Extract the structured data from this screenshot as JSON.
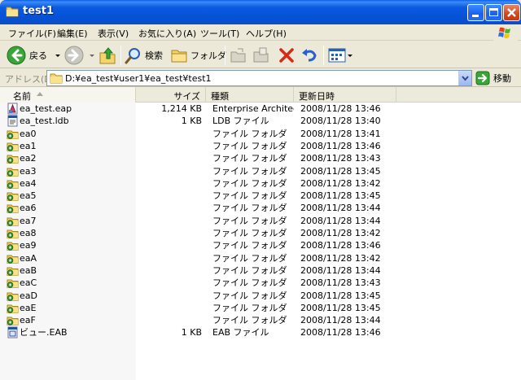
{
  "window": {
    "title": "test1",
    "minimize_icon": "minimize-icon",
    "maximize_icon": "maximize-icon",
    "close_icon": "close-icon"
  },
  "menu": [
    {
      "label": "ファイル(F)"
    },
    {
      "label": "編集(E)"
    },
    {
      "label": "表示(V)"
    },
    {
      "label": "お気に入り(A)"
    },
    {
      "label": "ツール(T)"
    },
    {
      "label": "ヘルプ(H)"
    }
  ],
  "toolbar": {
    "back_label": "戻る",
    "search_label": "検索",
    "folders_label": "フォルダ"
  },
  "address": {
    "label": "アドレス(D)",
    "value": "D:¥ea_test¥user1¥ea_test¥test1",
    "go_label": "移動"
  },
  "columns": [
    {
      "label": "名前"
    },
    {
      "label": "サイズ"
    },
    {
      "label": "種類"
    },
    {
      "label": "更新日時"
    }
  ],
  "files": [
    {
      "name": "ea_test.eap",
      "size": "1,214 KB",
      "type": "Enterprise Architec...",
      "date": "2008/11/28 13:46",
      "icon": "eap-file-icon"
    },
    {
      "name": "ea_test.ldb",
      "size": "1 KB",
      "type": "LDB ファイル",
      "date": "2008/11/28 13:40",
      "icon": "ldb-file-icon"
    },
    {
      "name": "ea0",
      "size": "",
      "type": "ファイル フォルダ",
      "date": "2008/11/28 13:41",
      "icon": "folder-icon"
    },
    {
      "name": "ea1",
      "size": "",
      "type": "ファイル フォルダ",
      "date": "2008/11/28 13:46",
      "icon": "folder-icon"
    },
    {
      "name": "ea2",
      "size": "",
      "type": "ファイル フォルダ",
      "date": "2008/11/28 13:43",
      "icon": "folder-icon"
    },
    {
      "name": "ea3",
      "size": "",
      "type": "ファイル フォルダ",
      "date": "2008/11/28 13:45",
      "icon": "folder-icon"
    },
    {
      "name": "ea4",
      "size": "",
      "type": "ファイル フォルダ",
      "date": "2008/11/28 13:42",
      "icon": "folder-icon"
    },
    {
      "name": "ea5",
      "size": "",
      "type": "ファイル フォルダ",
      "date": "2008/11/28 13:45",
      "icon": "folder-icon"
    },
    {
      "name": "ea6",
      "size": "",
      "type": "ファイル フォルダ",
      "date": "2008/11/28 13:44",
      "icon": "folder-icon"
    },
    {
      "name": "ea7",
      "size": "",
      "type": "ファイル フォルダ",
      "date": "2008/11/28 13:44",
      "icon": "folder-icon"
    },
    {
      "name": "ea8",
      "size": "",
      "type": "ファイル フォルダ",
      "date": "2008/11/28 13:42",
      "icon": "folder-icon"
    },
    {
      "name": "ea9",
      "size": "",
      "type": "ファイル フォルダ",
      "date": "2008/11/28 13:46",
      "icon": "folder-icon"
    },
    {
      "name": "eaA",
      "size": "",
      "type": "ファイル フォルダ",
      "date": "2008/11/28 13:42",
      "icon": "folder-icon"
    },
    {
      "name": "eaB",
      "size": "",
      "type": "ファイル フォルダ",
      "date": "2008/11/28 13:44",
      "icon": "folder-icon"
    },
    {
      "name": "eaC",
      "size": "",
      "type": "ファイル フォルダ",
      "date": "2008/11/28 13:43",
      "icon": "folder-icon"
    },
    {
      "name": "eaD",
      "size": "",
      "type": "ファイル フォルダ",
      "date": "2008/11/28 13:45",
      "icon": "folder-icon"
    },
    {
      "name": "eaE",
      "size": "",
      "type": "ファイル フォルダ",
      "date": "2008/11/28 13:45",
      "icon": "folder-icon"
    },
    {
      "name": "eaF",
      "size": "",
      "type": "ファイル フォルダ",
      "date": "2008/11/28 13:44",
      "icon": "folder-icon"
    },
    {
      "name": "ビュー.EAB",
      "size": "1 KB",
      "type": "EAB ファイル",
      "date": "2008/11/28 13:46",
      "icon": "eab-file-icon"
    }
  ],
  "colors": {
    "titlebar": "#0a5ae0",
    "window_bg": "#ece9d8",
    "folder_green": "#3aa03a",
    "folder_yellow": "#f0c850"
  }
}
